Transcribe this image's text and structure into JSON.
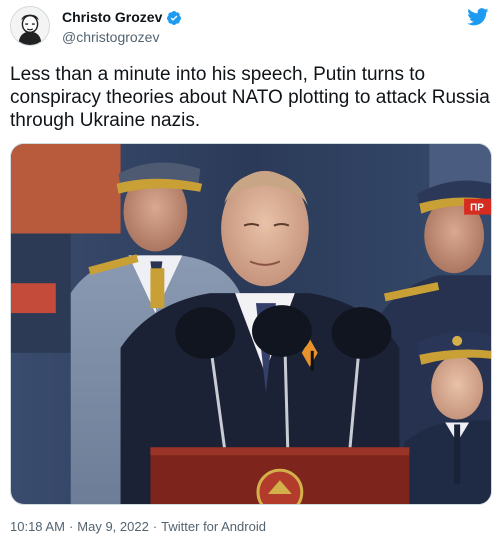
{
  "author": {
    "display_name": "Christo Grozev",
    "handle": "@christogrozev",
    "verified": true
  },
  "tweet": {
    "text": "Less than a minute into his speech, Putin turns to conspiracy theories about NATO plotting to attack Russia through Ukraine nazis."
  },
  "media": {
    "corner_badge": "ПР"
  },
  "meta": {
    "time": "10:18 AM",
    "separator": "·",
    "date": "May 9, 2022",
    "separator2": "·",
    "source": "Twitter for Android"
  },
  "colors": {
    "twitter_blue": "#1d9bf0",
    "text_primary": "#0f1419",
    "text_secondary": "#536471"
  },
  "icons": [
    "avatar-portrait",
    "verified-badge-icon",
    "twitter-bird-icon"
  ]
}
